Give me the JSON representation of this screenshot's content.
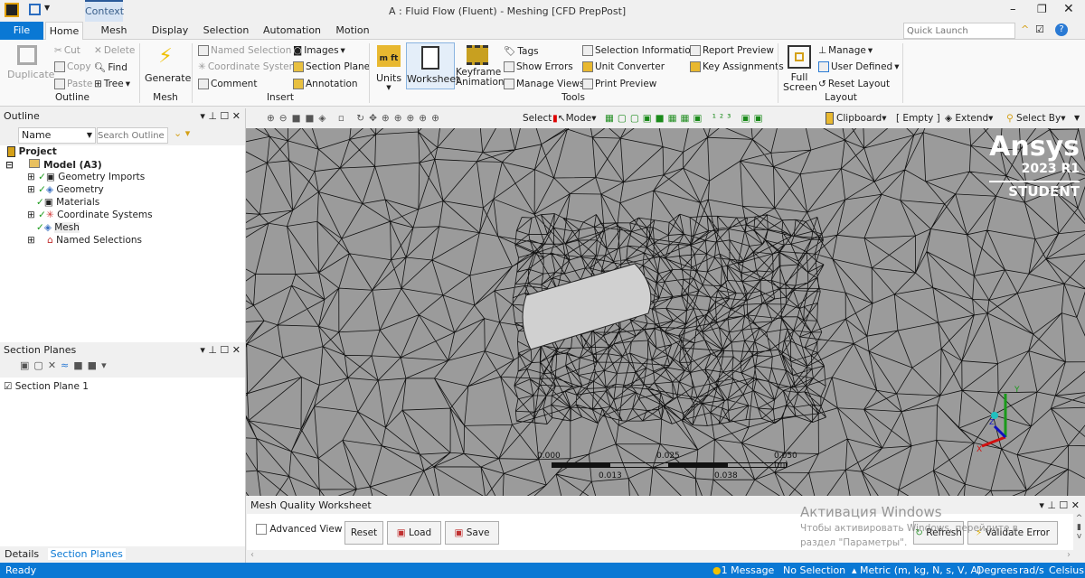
{
  "window": {
    "title": "A : Fluid Flow (Fluent) - Meshing [CFD PrepPost]",
    "context_tab": "Context",
    "quick_launch_placeholder": "Quick Launch"
  },
  "tabs": [
    "File",
    "Home",
    "Mesh",
    "Display",
    "Selection",
    "Automation",
    "Motion"
  ],
  "ribbon": {
    "outline": {
      "duplicate": "Duplicate",
      "cut": "Cut",
      "copy": "Copy",
      "paste": "Paste",
      "delete": "Delete",
      "find": "Find",
      "tree": "Tree",
      "label": "Outline"
    },
    "mesh": {
      "generate": "Generate",
      "label": "Mesh"
    },
    "insert": {
      "named_selection": "Named Selection",
      "coordinate_system": "Coordinate System",
      "comment": "Comment",
      "images": "Images",
      "section_plane": "Section Plane",
      "annotation": "Annotation",
      "label": "Insert"
    },
    "tools": {
      "units": "Units",
      "worksheet": "Worksheet",
      "keyframe": "Keyframe",
      "animation": "Animation",
      "tags": "Tags",
      "show_errors": "Show Errors",
      "manage_views": "Manage Views",
      "selection_information": "Selection Information",
      "unit_converter": "Unit Converter",
      "print_preview": "Print Preview",
      "report_preview": "Report Preview",
      "key_assignments": "Key Assignments",
      "label": "Tools"
    },
    "layout": {
      "full": "Full",
      "screen": "Screen",
      "manage": "Manage",
      "user_defined": "User Defined",
      "reset_layout": "Reset Layout",
      "label": "Layout"
    }
  },
  "toolbar": {
    "select": "Select",
    "mode": "Mode",
    "clipboard": "Clipboard",
    "empty": "[ Empty ]",
    "extend": "Extend",
    "select_by": "Select By"
  },
  "outline": {
    "title": "Outline",
    "name_filter": "Name",
    "search_placeholder": "Search Outline",
    "project": "Project",
    "model": "Model (A3)",
    "items": [
      "Geometry Imports",
      "Geometry",
      "Materials",
      "Coordinate Systems",
      "Mesh",
      "Named Selections"
    ]
  },
  "section_planes": {
    "title": "Section Planes",
    "items": [
      "Section Plane 1"
    ]
  },
  "bottom_tabs": [
    "Details",
    "Section Planes"
  ],
  "viewport": {
    "brand": "Ansys",
    "version": "2023 R1",
    "edition": "STUDENT",
    "scale": {
      "top": [
        "0.000",
        "0.025",
        "0.050 (m)"
      ],
      "bottom": [
        "0.013",
        "0.038"
      ]
    },
    "axes": [
      "X",
      "Y",
      "Z"
    ]
  },
  "worksheet": {
    "title": "Mesh Quality Worksheet",
    "advanced_view": "Advanced View",
    "reset": "Reset",
    "load": "Load",
    "save": "Save",
    "refresh": "Refresh",
    "validate_error": "Validate Error"
  },
  "watermark": {
    "line1": "Активация Windows",
    "line2": "Чтобы активировать Windows, перейдите в",
    "line3": "раздел \"Параметры\"."
  },
  "status": {
    "ready": "Ready",
    "messages": "1 Message",
    "selection": "No Selection",
    "units": "Metric (m, kg, N, s, V, A)",
    "angle": "Degrees",
    "rate": "rad/s",
    "temp": "Celsius"
  },
  "colors": {
    "accent": "#0a78d4",
    "mesh_bg": "#9b9b9b",
    "gold": "#d4a017"
  }
}
